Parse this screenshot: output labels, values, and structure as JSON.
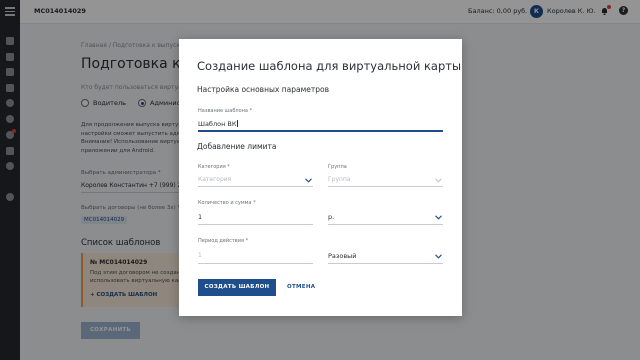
{
  "header": {
    "account_id": "MC014014029",
    "balance": "Баланс: 0,00 руб.",
    "avatar_initial": "К",
    "user_name": "Королев К. Ю.",
    "help_glyph": "?"
  },
  "sidebar": {
    "icons": [
      "home-icon",
      "grid-icon",
      "document-icon",
      "list-icon",
      "user-icon",
      "settings-icon",
      "notification-icon",
      "card-icon",
      "chat-icon",
      "gear-icon"
    ]
  },
  "page": {
    "breadcrumb": "Главная / Подготовка к выпуску в",
    "title": "Подготовка к вып",
    "who_question": "Кто будет пользоваться виртуальн",
    "radio_driver": "Водитель",
    "radio_admin": "Админис",
    "info_lines": [
      "Для продолжения выпуска виртуа",
      "настройки сможет выпустить адми",
      "Внимание! Использование виртуа",
      "приложении для Android."
    ],
    "admin_label": "Выбрать администратора *",
    "admin_value": "Королев Константин +7 (999) 205-0",
    "contracts_label": "Выбрать договоры (не более 3х) *",
    "contract_chip": "MC014014029",
    "templates_title": "Список шаблонов",
    "card_id": "№ MC014014029",
    "card_text_lines": [
      "Под этим договором не создан",
      "использовать виртуальную карт"
    ],
    "card_link": "+ СОЗДАТЬ ШАБЛОН",
    "save_button": "СОХРАНИТЬ"
  },
  "modal": {
    "title": "Создание шаблона для виртуальной карты",
    "section_basic": "Настройка основных параметров",
    "template_name_label": "Название шаблона *",
    "template_name_value": "Шаблон ВК",
    "section_limit": "Добавление лимита",
    "category_label": "Категория *",
    "category_placeholder": "Категория",
    "group_label": "Группа",
    "group_placeholder": "Группа",
    "qty_label": "Количество и сумма *",
    "qty_value": "1",
    "unit_value": "р.",
    "period_label": "Период действия *",
    "period_placeholder": "1",
    "period_type_value": "Разовый",
    "create_button": "СОЗДАТЬ ШАБЛОН",
    "cancel_button": "ОТМЕНА"
  },
  "colors": {
    "primary": "#1f4e8c",
    "sidebar": "#25282d",
    "accent_warning": "#e8a04a",
    "notification": "#e0463c"
  }
}
